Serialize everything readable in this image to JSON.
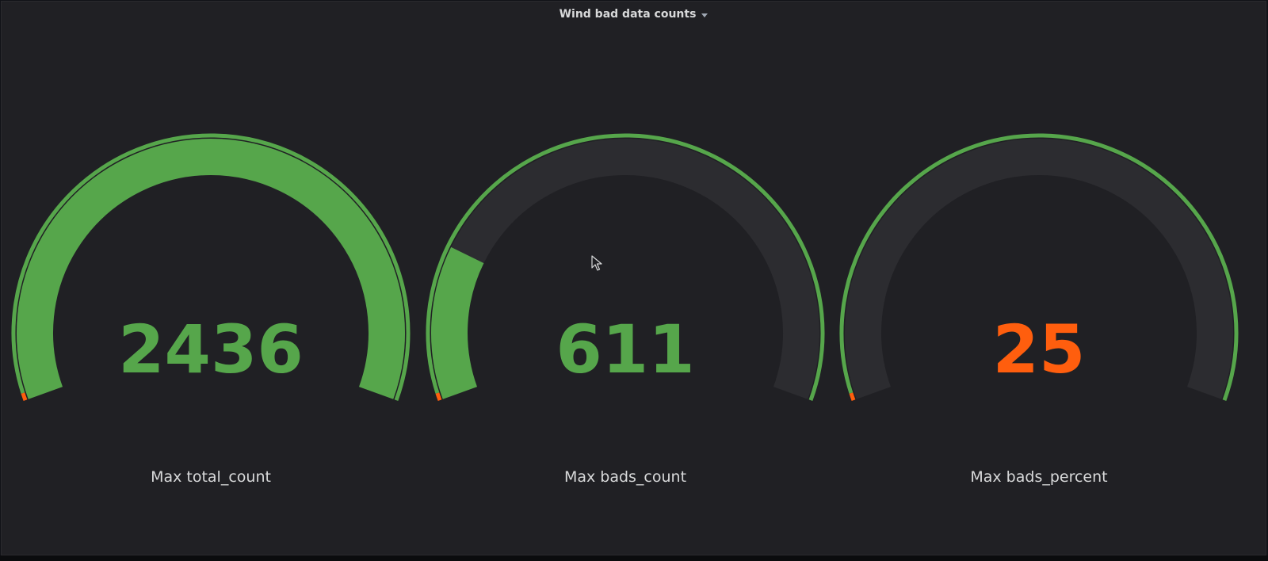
{
  "panel": {
    "title": "Wind bad data counts"
  },
  "colors": {
    "green": "#56A64B",
    "orange": "#FF5E0E",
    "track": "#2C2C30",
    "background": "#202024"
  },
  "gauges": [
    {
      "label": "Max total_count",
      "value": "2436",
      "fill_fraction": 1.0,
      "value_color": "#56A64B"
    },
    {
      "label": "Max bads_count",
      "value": "611",
      "fill_fraction": 0.21,
      "value_color": "#56A64B"
    },
    {
      "label": "Max bads_percent",
      "value": "25",
      "fill_fraction": 0.0,
      "value_color": "#FF5E0E"
    }
  ],
  "icons": {
    "dropdown": "chevron-down-icon",
    "cursor": "mouse-pointer-icon"
  }
}
